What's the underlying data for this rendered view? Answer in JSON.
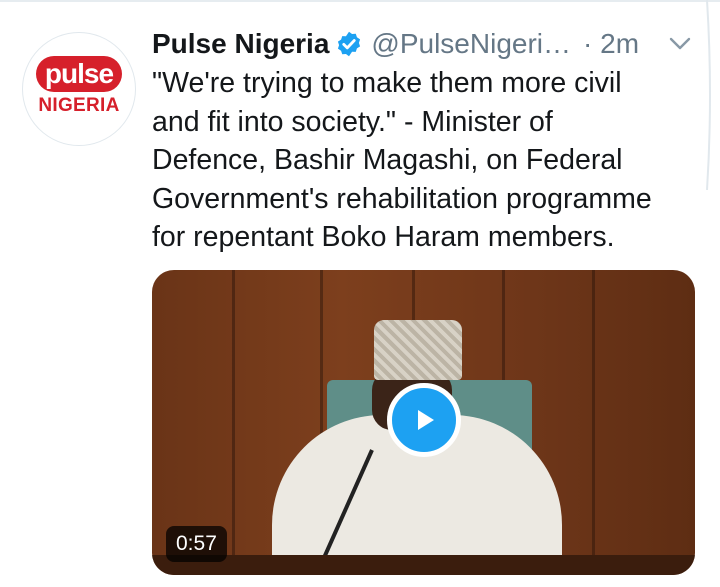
{
  "tweet": {
    "author_name": "Pulse Nigeria",
    "handle": "@PulseNigeri…",
    "time": "· 2m",
    "text": "\"We're trying to make them more civil\nand fit into society.\" - Minister of\nDefence, Bashir Magashi, on Federal\nGovernment's rehabilitation programme\nfor repentant Boko Haram members.",
    "verified": true
  },
  "avatar": {
    "logo_word": "pulse",
    "logo_subtitle": "NIGERIA",
    "brand_color": "#d6202b"
  },
  "media": {
    "type": "video",
    "duration": "0:57",
    "play_icon": "play-icon",
    "accent": "#1da1f2"
  },
  "colors": {
    "text": "#14171a",
    "secondary": "#657786",
    "verified": "#1da1f2"
  }
}
